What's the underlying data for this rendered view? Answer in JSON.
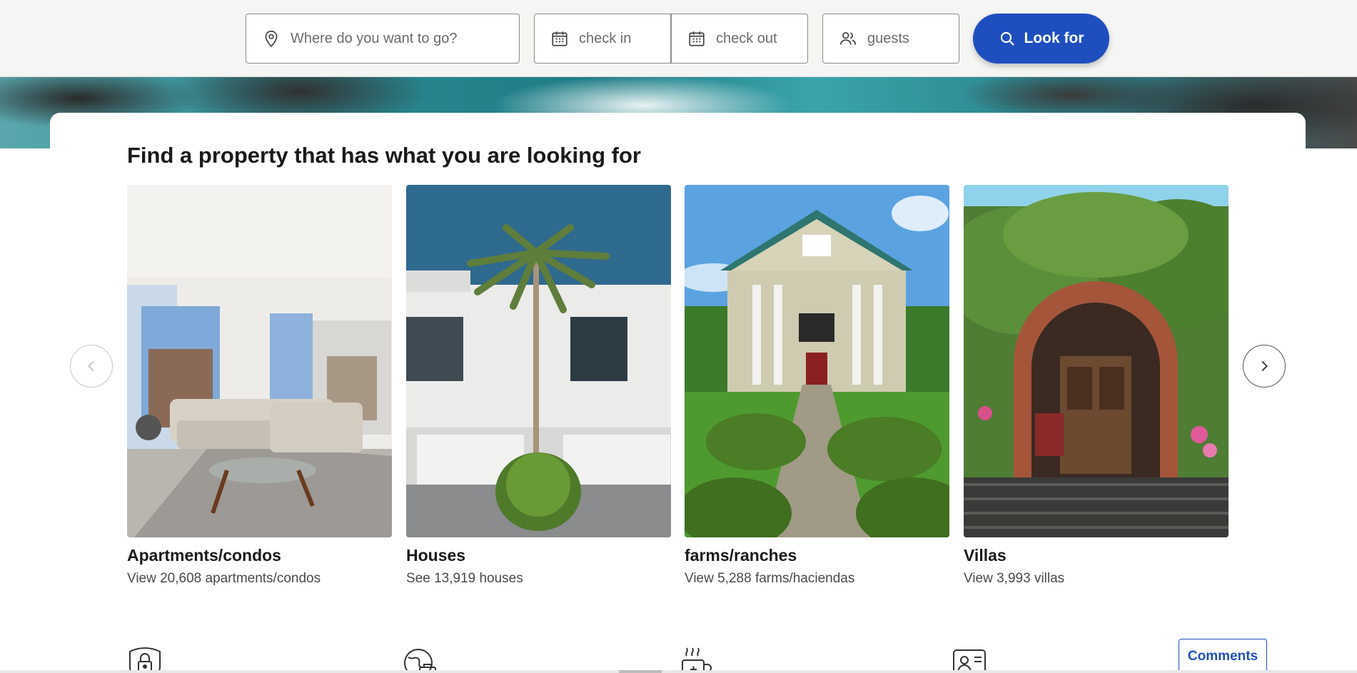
{
  "search": {
    "destination_placeholder": "Where do you want to go?",
    "checkin_placeholder": "check in",
    "checkout_placeholder": "check out",
    "guests_placeholder": "guests",
    "submit_label": "Look for"
  },
  "main": {
    "heading": "Find a property that has what you are looking for",
    "categories": [
      {
        "title": "Apartments/condos",
        "link": "View 20,608 apartments/condos"
      },
      {
        "title": "Houses",
        "link": "See 13,919 houses"
      },
      {
        "title": "farms/ranches",
        "link": "View 5,288 farms/haciendas"
      },
      {
        "title": "Villas",
        "link": "View 3,993 villas"
      }
    ]
  },
  "feedback": {
    "label": "Comments"
  },
  "colors": {
    "accent": "#1f4fbf",
    "background": "#f5f5f4"
  },
  "icons": [
    "location-pin-icon",
    "calendar-icon",
    "users-icon",
    "search-icon",
    "chevron-left-icon",
    "chevron-right-icon",
    "lock-icon",
    "globe-suitcase-icon",
    "hot-cup-icon",
    "id-card-icon"
  ]
}
